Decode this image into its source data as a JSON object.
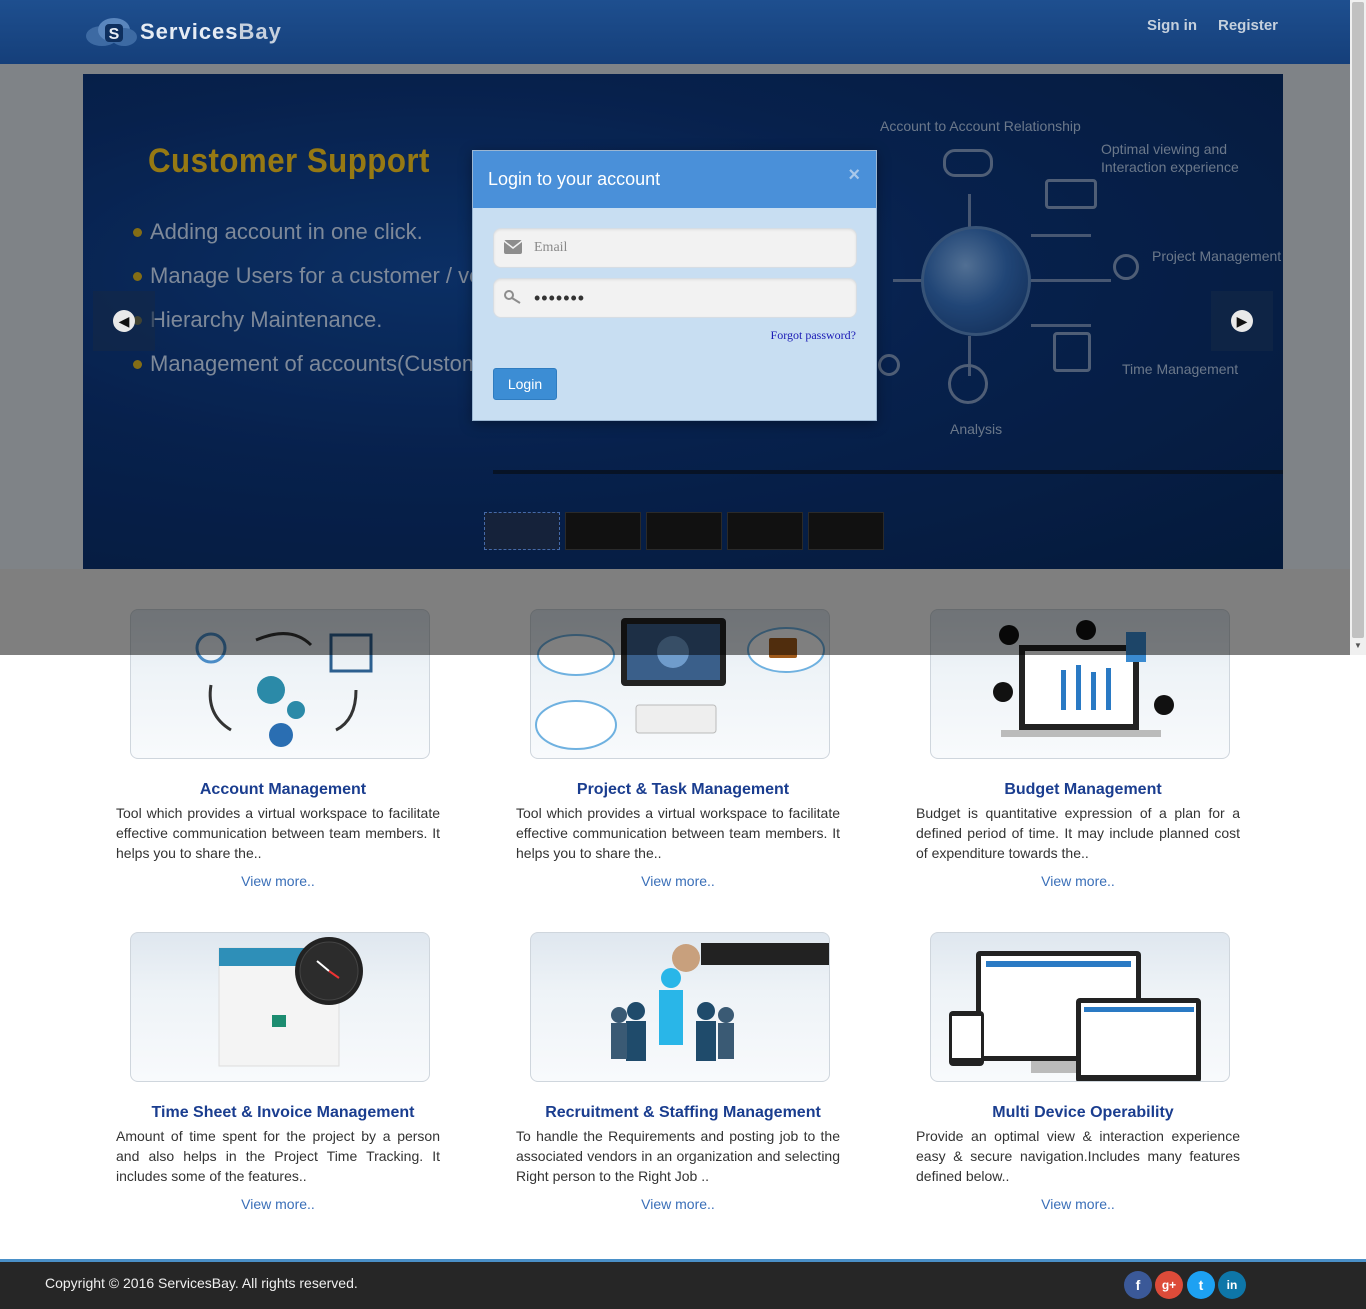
{
  "header": {
    "logo_text_a": "Services",
    "logo_text_b": "Bay",
    "sign_in": "Sign in",
    "register": "Register"
  },
  "slider": {
    "title": "Customer Support",
    "bullets": [
      "Adding account in one click.",
      "Manage Users for a customer / vendor",
      "Hierarchy Maintenance.",
      "Management of accounts(Customer/ve"
    ],
    "diagram_labels": {
      "relationship": "Account to Account Relationship",
      "optimal": "Optimal viewing and Interaction experience",
      "project": "Project Management",
      "time": "Time Management",
      "analysis": "Analysis"
    },
    "thumbnail_count": 5,
    "active_thumbnail": 1
  },
  "modal": {
    "title": "Login to your account",
    "close_label": "×",
    "email_placeholder": "Email",
    "password_value": "1234567",
    "forgot_password": "Forgot password?",
    "login_button": "Login"
  },
  "features": [
    {
      "title": "Account Management",
      "desc": "Tool which provides a virtual workspace to facilitate effective communication between team members. It helps you to share the..",
      "more": "View more.."
    },
    {
      "title": "Project & Task Management",
      "desc": "Tool which provides a virtual workspace to facilitate effective communication between team members. It helps you to share the..",
      "more": "View more.."
    },
    {
      "title": "Budget Management",
      "desc": "Budget is quantitative expression of a plan for a defined period of time. It may include planned cost of expenditure towards the..",
      "more": "View more.."
    },
    {
      "title": "Time Sheet & Invoice Management",
      "desc": "Amount of time spent for the project by a person and also helps in the Project Time Tracking. It includes some of the features..",
      "more": "View more.."
    },
    {
      "title": "Recruitment & Staffing Management",
      "desc": "To handle the Requirements and posting job to the associated vendors in an organization and selecting Right person to the Right Job ..",
      "more": "View more.."
    },
    {
      "title": "Multi Device Operability",
      "desc": "Provide an optimal view & interaction experience easy & secure navigation.Includes many features defined below..",
      "more": "View more.."
    }
  ],
  "footer": {
    "copyright": "Copyright © 2016 ServicesBay. All rights reserved.",
    "social": [
      {
        "icon": "facebook-icon",
        "glyph": "f",
        "color": "#3b5998"
      },
      {
        "icon": "google-plus-icon",
        "glyph": "g+",
        "color": "#dd4b39"
      },
      {
        "icon": "twitter-icon",
        "glyph": "t",
        "color": "#1da1f2"
      },
      {
        "icon": "linkedin-icon",
        "glyph": "in",
        "color": "#0e76a8"
      }
    ]
  },
  "colors": {
    "navbar": "#1e4f8f",
    "accent": "#4a90d9",
    "feature_title": "#1a3d8f",
    "link": "#3a6fb8"
  }
}
